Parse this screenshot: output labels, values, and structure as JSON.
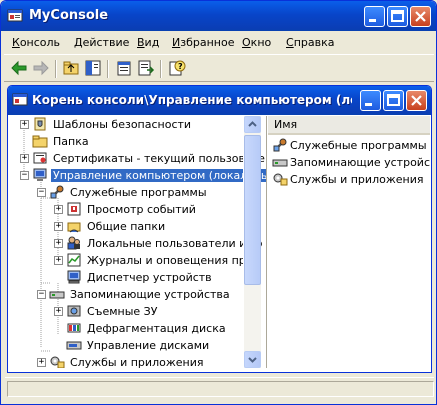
{
  "window": {
    "title": "MyConsole"
  },
  "menu": [
    {
      "label": "Консоль",
      "u": "К",
      "rest": "онсоль"
    },
    {
      "label": "Действие",
      "u": "Д",
      "rest": "ействие"
    },
    {
      "label": "Вид",
      "u": "В",
      "rest": "ид"
    },
    {
      "label": "Избранное",
      "u": "И",
      "rest": "збранное"
    },
    {
      "label": "Окно",
      "u": "О",
      "rest": "кно"
    },
    {
      "label": "Справка",
      "u": "С",
      "rest": "правка"
    }
  ],
  "toolbar": [
    "back-arrow-icon",
    "forward-arrow-icon",
    "up-folder-icon",
    "show-hide-tree-icon",
    "properties-icon",
    "export-list-icon",
    "help-icon"
  ],
  "inner": {
    "title": "Корень консоли\\Управление компьютером (лока..."
  },
  "tree": {
    "items": [
      {
        "label": "Шаблоны безопасности",
        "icon": "security-templates-icon",
        "expander": "+"
      },
      {
        "label": "Папка",
        "icon": "folder-icon",
        "expander": ""
      },
      {
        "label": "Сертификаты - текущий пользовате",
        "icon": "certificates-icon",
        "expander": "+"
      },
      {
        "label": "Управление компьютером (локальны",
        "icon": "computer-management-icon",
        "expander": "-",
        "selected": true
      },
      {
        "label": "Служебные программы",
        "icon": "system-tools-icon",
        "expander": "-"
      },
      {
        "label": "Просмотр событий",
        "icon": "event-viewer-icon",
        "expander": "+"
      },
      {
        "label": "Общие папки",
        "icon": "shared-folders-icon",
        "expander": "+"
      },
      {
        "label": "Локальные пользователи и гр",
        "icon": "local-users-icon",
        "expander": "+"
      },
      {
        "label": "Журналы и оповещения прои",
        "icon": "performance-logs-icon",
        "expander": "+"
      },
      {
        "label": "Диспетчер устройств",
        "icon": "device-manager-icon",
        "expander": ""
      },
      {
        "label": "Запоминающие устройства",
        "icon": "storage-icon",
        "expander": "-"
      },
      {
        "label": "Съемные ЗУ",
        "icon": "removable-storage-icon",
        "expander": "+"
      },
      {
        "label": "Дефрагментация диска",
        "icon": "defrag-icon",
        "expander": ""
      },
      {
        "label": "Управление дисками",
        "icon": "disk-management-icon",
        "expander": ""
      },
      {
        "label": "Службы и приложения",
        "icon": "services-apps-icon",
        "expander": "+"
      }
    ]
  },
  "list": {
    "column": "Имя",
    "items": [
      {
        "label": "Служебные программы",
        "icon": "system-tools-icon"
      },
      {
        "label": "Запоминающие устройства",
        "icon": "storage-icon"
      },
      {
        "label": "Службы и приложения",
        "icon": "services-apps-icon"
      }
    ]
  },
  "colors": {
    "titlebar": "#0A4FD8",
    "selection": "#316AC5",
    "chrome": "#ECE9D8"
  }
}
